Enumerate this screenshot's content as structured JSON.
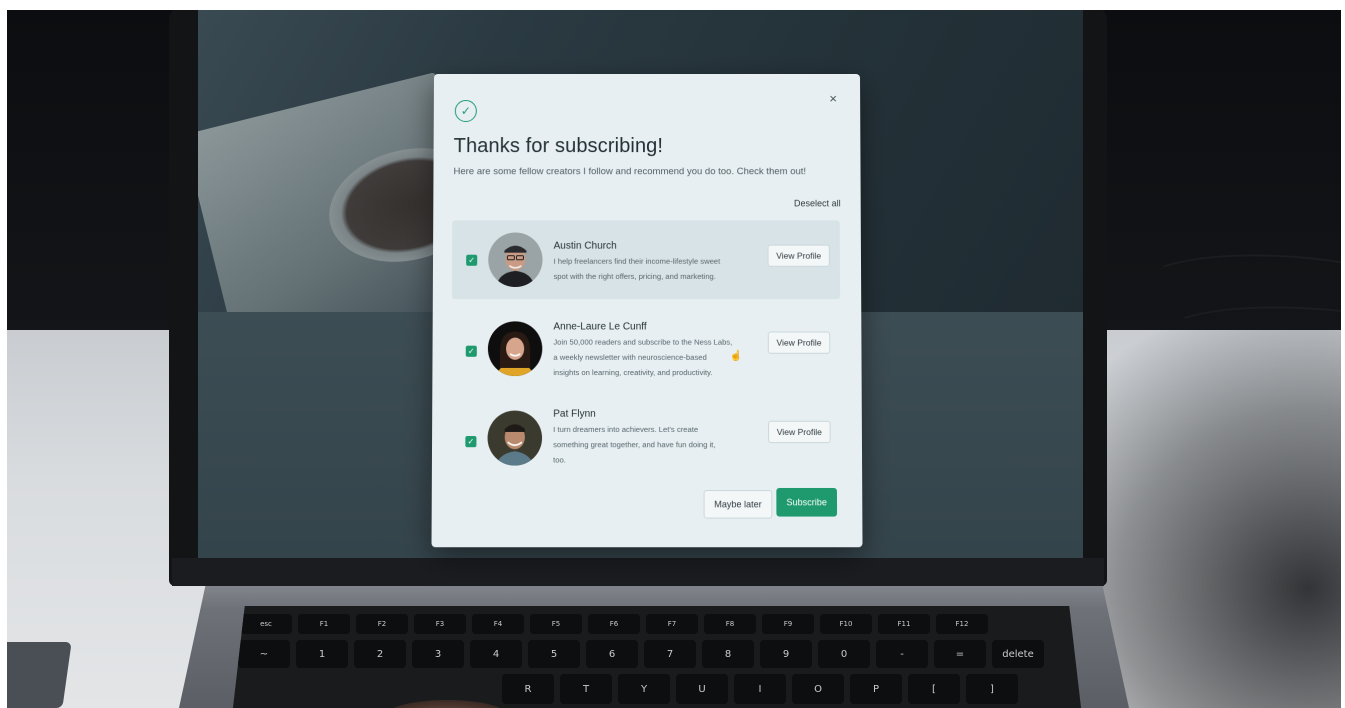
{
  "modal": {
    "title": "Thanks for subscribing!",
    "subtitle": "Here are some fellow creators I follow and recommend you do too. Check them out!",
    "deselect_all": "Deselect all",
    "close_glyph": "×",
    "check_glyph": "✓",
    "maybe_later": "Maybe later",
    "subscribe": "Subscribe",
    "accent_color": "#1f9a6f"
  },
  "creators": [
    {
      "name": "Austin Church",
      "bio_lines": [
        "I help freelancers find their income-lifestyle sweet",
        "spot with the right offers, pricing, and marketing."
      ],
      "checked": true,
      "view_profile": "View Profile"
    },
    {
      "name": "Anne-Laure Le Cunff",
      "bio_lines": [
        "Join 50,000 readers and subscribe to the Ness Labs,",
        "a weekly newsletter with neuroscience-based",
        "insights on learning, creativity, and productivity."
      ],
      "checked": true,
      "view_profile": "View Profile"
    },
    {
      "name": "Pat Flynn",
      "bio_lines": [
        "I turn dreamers into achievers. Let's create",
        "something great together, and have fun doing it,",
        "too."
      ],
      "checked": true,
      "view_profile": "View Profile"
    }
  ],
  "keyboard": {
    "fn_row": [
      "esc",
      "F1",
      "F2",
      "F3",
      "F4",
      "F5",
      "F6",
      "F7",
      "F8",
      "F9",
      "F10",
      "F11",
      "F12"
    ],
    "num_row": [
      "~",
      "1",
      "2",
      "3",
      "4",
      "5",
      "6",
      "7",
      "8",
      "9",
      "0",
      "-",
      "=",
      "delete"
    ],
    "letter_row": [
      "R",
      "T",
      "Y",
      "U",
      "I",
      "O",
      "P",
      "[",
      "]"
    ]
  }
}
